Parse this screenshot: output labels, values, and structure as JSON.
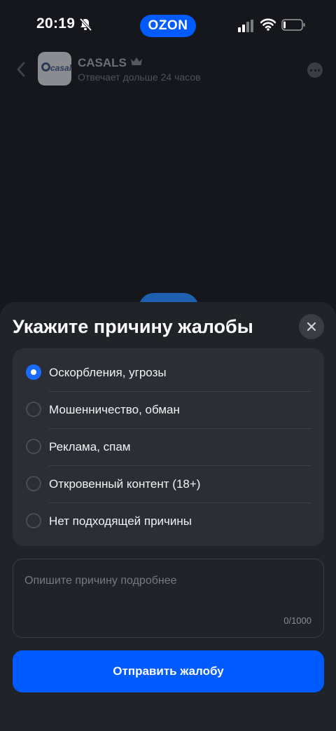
{
  "status_bar": {
    "time": "20:19",
    "brand": "OZON"
  },
  "chat_header": {
    "shop_name": "CASALS",
    "shop_status": "Отвечает дольше 24 часов",
    "avatar_text": "casals"
  },
  "sheet": {
    "title": "Укажите причину жалобы",
    "reasons": [
      {
        "label": "Оскорбления, угрозы",
        "selected": true
      },
      {
        "label": "Мошенничество, обман",
        "selected": false
      },
      {
        "label": "Реклама, спам",
        "selected": false
      },
      {
        "label": "Откровенный контент (18+)",
        "selected": false
      },
      {
        "label": "Нет подходящей причины",
        "selected": false
      }
    ],
    "details": {
      "placeholder": "Опишите причину подробнее",
      "value": "",
      "counter": "0/1000"
    },
    "submit_label": "Отправить жалобу"
  },
  "colors": {
    "accent": "#005bff",
    "radio_selected": "#1a6bff",
    "sheet_bg": "#202328",
    "card_bg": "#2b2e34"
  }
}
